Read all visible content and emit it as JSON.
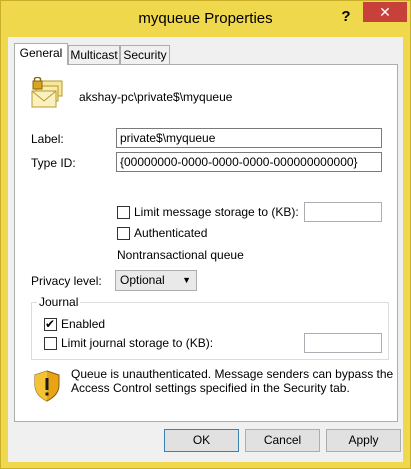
{
  "window": {
    "title": "myqueue Properties",
    "help": "?",
    "close": "✕"
  },
  "tabs": [
    {
      "label": "General",
      "active": true
    },
    {
      "label": "Multicast",
      "active": false
    },
    {
      "label": "Security",
      "active": false
    }
  ],
  "general": {
    "queue_path": "akshay-pc\\private$\\myqueue",
    "label_caption": "Label:",
    "label_value": "private$\\myqueue",
    "typeid_caption": "Type ID:",
    "typeid_value": "{00000000-0000-0000-0000-000000000000}",
    "limit_storage_label": "Limit message storage to (KB):",
    "limit_storage_checked": false,
    "limit_storage_value": "",
    "authenticated_label": "Authenticated",
    "authenticated_checked": false,
    "transactional_text": "Nontransactional queue",
    "privacy_caption": "Privacy level:",
    "privacy_value": "Optional",
    "journal": {
      "title": "Journal",
      "enabled_label": "Enabled",
      "enabled_checked": true,
      "limit_label": "Limit journal storage to (KB):",
      "limit_checked": false,
      "limit_value": ""
    },
    "warning_text_1": "Queue is unauthenticated. Message senders can bypass the",
    "warning_text_2": "Access Control settings specified in the Security tab."
  },
  "buttons": {
    "ok": "OK",
    "cancel": "Cancel",
    "apply": "Apply"
  },
  "colors": {
    "frame": "#f0d84c",
    "close": "#c7413a",
    "default_border": "#3c7fb1"
  }
}
